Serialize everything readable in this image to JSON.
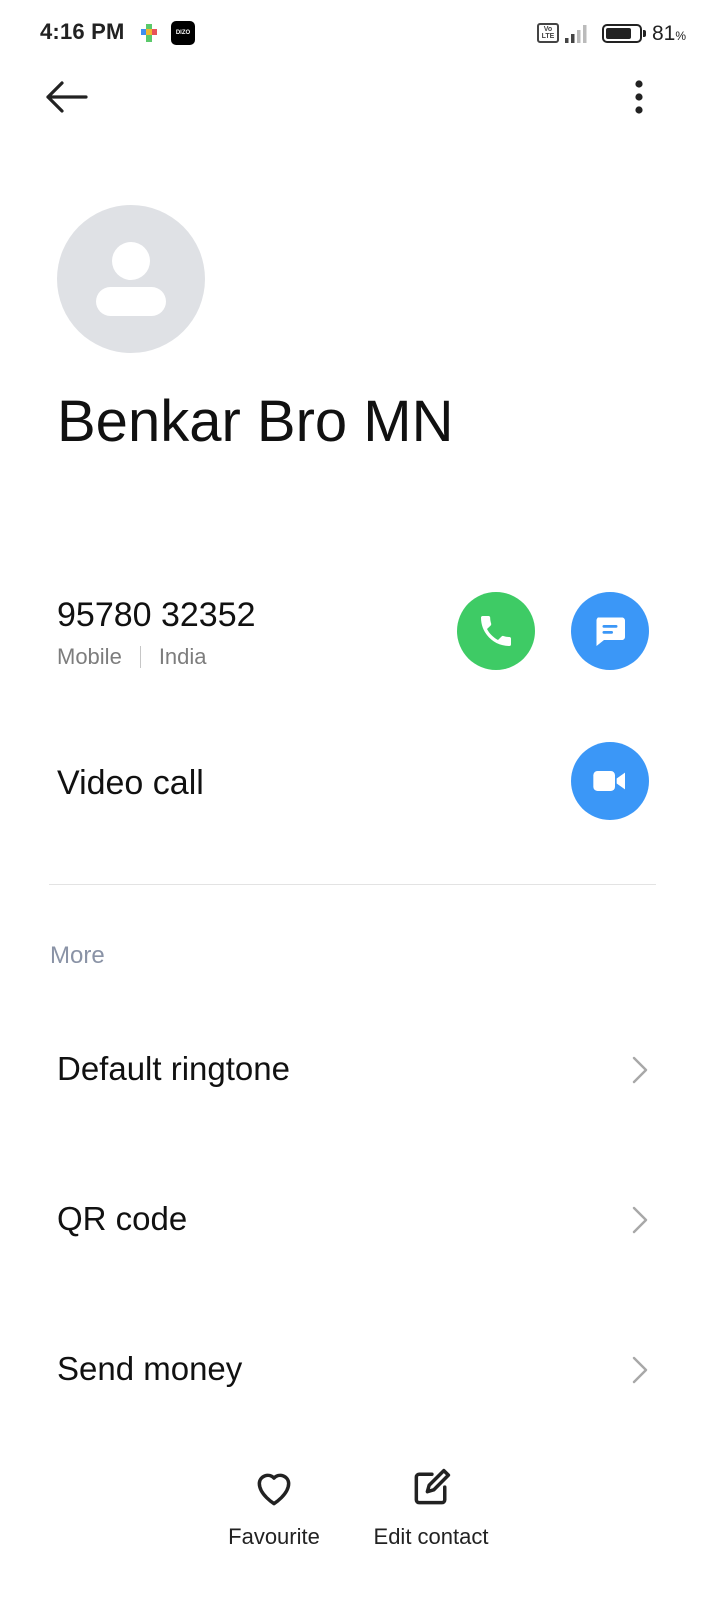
{
  "status_bar": {
    "time": "4:16 PM",
    "volte": "Vo LTE",
    "app_icon_label": "DIZO",
    "battery_level": 81,
    "battery_text": "81",
    "battery_unit": "%"
  },
  "top_bar": {
    "back_icon": "arrow-left-icon",
    "menu_icon": "more-vertical-icon"
  },
  "contact": {
    "name": "Benkar Bro MN",
    "avatar_icon": "person-placeholder-icon"
  },
  "phone": {
    "number": "95780 32352",
    "type": "Mobile",
    "country": "India"
  },
  "video_call": {
    "label": "Video call"
  },
  "colors": {
    "call_green": "#3ecb65",
    "action_blue": "#3b97f7",
    "section_label": "#8a93a6"
  },
  "more_section": {
    "title": "More",
    "items": [
      {
        "label": "Default ringtone"
      },
      {
        "label": "QR code"
      },
      {
        "label": "Send money"
      }
    ]
  },
  "bottom_bar": {
    "favourite_label": "Favourite",
    "edit_label": "Edit contact"
  }
}
